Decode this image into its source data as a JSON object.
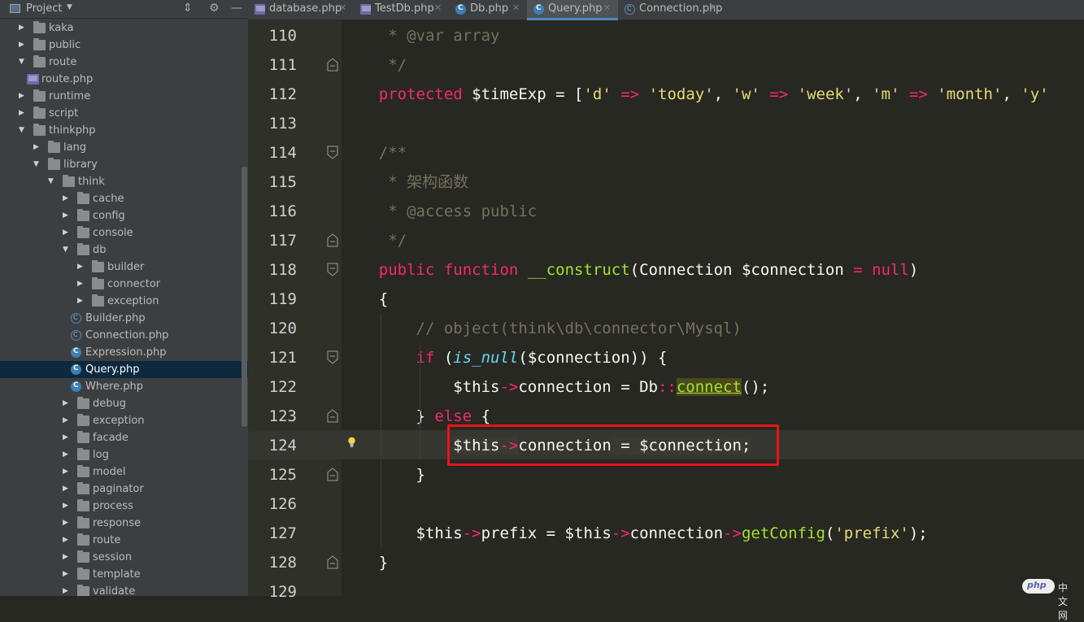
{
  "project_panel": {
    "title": "Project",
    "tree": [
      {
        "label": "kaka",
        "type": "folder",
        "expanded": false,
        "depth": 0
      },
      {
        "label": "public",
        "type": "folder",
        "expanded": false,
        "depth": 0
      },
      {
        "label": "route",
        "type": "folder",
        "expanded": true,
        "depth": 0
      },
      {
        "label": "route.php",
        "type": "php",
        "depth": 1
      },
      {
        "label": "runtime",
        "type": "folder",
        "expanded": false,
        "depth": 0
      },
      {
        "label": "script",
        "type": "folder",
        "expanded": false,
        "depth": 0
      },
      {
        "label": "thinkphp",
        "type": "folder",
        "expanded": true,
        "depth": 0
      },
      {
        "label": "lang",
        "type": "folder",
        "expanded": false,
        "depth": 1
      },
      {
        "label": "library",
        "type": "folder",
        "expanded": true,
        "depth": 1
      },
      {
        "label": "think",
        "type": "folder",
        "expanded": true,
        "depth": 2
      },
      {
        "label": "cache",
        "type": "folder",
        "expanded": false,
        "depth": 3
      },
      {
        "label": "config",
        "type": "folder",
        "expanded": false,
        "depth": 3
      },
      {
        "label": "console",
        "type": "folder",
        "expanded": false,
        "depth": 3
      },
      {
        "label": "db",
        "type": "folder",
        "expanded": true,
        "depth": 3
      },
      {
        "label": "builder",
        "type": "folder",
        "expanded": false,
        "depth": 4
      },
      {
        "label": "connector",
        "type": "folder",
        "expanded": false,
        "depth": 4
      },
      {
        "label": "exception",
        "type": "folder",
        "expanded": false,
        "depth": 4
      },
      {
        "label": "Builder.php",
        "type": "abstract",
        "depth": 4
      },
      {
        "label": "Connection.php",
        "type": "abstract",
        "depth": 4
      },
      {
        "label": "Expression.php",
        "type": "class",
        "depth": 4
      },
      {
        "label": "Query.php",
        "type": "class",
        "depth": 4,
        "selected": true
      },
      {
        "label": "Where.php",
        "type": "class",
        "depth": 4
      },
      {
        "label": "debug",
        "type": "folder",
        "expanded": false,
        "depth": 3
      },
      {
        "label": "exception",
        "type": "folder",
        "expanded": false,
        "depth": 3
      },
      {
        "label": "facade",
        "type": "folder",
        "expanded": false,
        "depth": 3
      },
      {
        "label": "log",
        "type": "folder",
        "expanded": false,
        "depth": 3
      },
      {
        "label": "model",
        "type": "folder",
        "expanded": false,
        "depth": 3
      },
      {
        "label": "paginator",
        "type": "folder",
        "expanded": false,
        "depth": 3
      },
      {
        "label": "process",
        "type": "folder",
        "expanded": false,
        "depth": 3
      },
      {
        "label": "response",
        "type": "folder",
        "expanded": false,
        "depth": 3
      },
      {
        "label": "route",
        "type": "folder",
        "expanded": false,
        "depth": 3
      },
      {
        "label": "session",
        "type": "folder",
        "expanded": false,
        "depth": 3
      },
      {
        "label": "template",
        "type": "folder",
        "expanded": false,
        "depth": 3
      },
      {
        "label": "validate",
        "type": "folder",
        "expanded": false,
        "depth": 3
      }
    ]
  },
  "tabs": [
    {
      "label": "database.php",
      "icon": "php-file-icon",
      "active": false
    },
    {
      "label": "TestDb.php",
      "icon": "php-test-file-icon",
      "active": false
    },
    {
      "label": "Db.php",
      "icon": "class-icon",
      "active": false
    },
    {
      "label": "Query.php",
      "icon": "class-icon",
      "active": true
    },
    {
      "label": "Connection.php",
      "icon": "abstract-class-icon",
      "active": false
    }
  ],
  "editor": {
    "current_line": 124,
    "lines": [
      {
        "n": "110",
        "fold": "",
        "segs": [
          {
            "t": "     * @var array",
            "c": "comment"
          }
        ]
      },
      {
        "n": "111",
        "fold": "end",
        "segs": [
          {
            "t": "     */",
            "c": "comment"
          }
        ]
      },
      {
        "n": "112",
        "fold": "",
        "segs": [
          {
            "t": "    ",
            "c": ""
          },
          {
            "t": "protected",
            "c": "kw"
          },
          {
            "t": " $timeExp = [",
            "c": ""
          },
          {
            "t": "'d'",
            "c": "str"
          },
          {
            "t": " ",
            "c": ""
          },
          {
            "t": "=>",
            "c": "op"
          },
          {
            "t": " ",
            "c": ""
          },
          {
            "t": "'today'",
            "c": "str"
          },
          {
            "t": ", ",
            "c": ""
          },
          {
            "t": "'w'",
            "c": "str"
          },
          {
            "t": " ",
            "c": ""
          },
          {
            "t": "=>",
            "c": "op"
          },
          {
            "t": " ",
            "c": ""
          },
          {
            "t": "'week'",
            "c": "str"
          },
          {
            "t": ", ",
            "c": ""
          },
          {
            "t": "'m'",
            "c": "str"
          },
          {
            "t": " ",
            "c": ""
          },
          {
            "t": "=>",
            "c": "op"
          },
          {
            "t": " ",
            "c": ""
          },
          {
            "t": "'month'",
            "c": "str"
          },
          {
            "t": ", ",
            "c": ""
          },
          {
            "t": "'y'",
            "c": "str"
          }
        ]
      },
      {
        "n": "113",
        "fold": "",
        "segs": []
      },
      {
        "n": "114",
        "fold": "start",
        "segs": [
          {
            "t": "    /**",
            "c": "comment"
          }
        ]
      },
      {
        "n": "115",
        "fold": "",
        "segs": [
          {
            "t": "     * 架构函数",
            "c": "comment"
          }
        ]
      },
      {
        "n": "116",
        "fold": "",
        "segs": [
          {
            "t": "     * @access public",
            "c": "comment"
          }
        ]
      },
      {
        "n": "117",
        "fold": "end",
        "segs": [
          {
            "t": "     */",
            "c": "comment"
          }
        ]
      },
      {
        "n": "118",
        "fold": "start",
        "segs": [
          {
            "t": "    ",
            "c": ""
          },
          {
            "t": "public",
            "c": "kw"
          },
          {
            "t": " ",
            "c": ""
          },
          {
            "t": "function",
            "c": "kw"
          },
          {
            "t": " ",
            "c": ""
          },
          {
            "t": "__construct",
            "c": "func"
          },
          {
            "t": "(Connection $connection ",
            "c": ""
          },
          {
            "t": "=",
            "c": "op"
          },
          {
            "t": " ",
            "c": ""
          },
          {
            "t": "null",
            "c": "kw"
          },
          {
            "t": ")",
            "c": ""
          }
        ]
      },
      {
        "n": "119",
        "fold": "",
        "segs": [
          {
            "t": "    {",
            "c": ""
          }
        ]
      },
      {
        "n": "120",
        "fold": "",
        "segs": [
          {
            "t": "        // object(think\\db\\connector\\Mysql)",
            "c": "comment"
          }
        ]
      },
      {
        "n": "121",
        "fold": "start",
        "segs": [
          {
            "t": "        ",
            "c": ""
          },
          {
            "t": "if",
            "c": "kw"
          },
          {
            "t": " (",
            "c": ""
          },
          {
            "t": "is_null",
            "c": "builtin"
          },
          {
            "t": "($connection)) {",
            "c": ""
          }
        ]
      },
      {
        "n": "122",
        "fold": "",
        "segs": [
          {
            "t": "            $this",
            "c": ""
          },
          {
            "t": "->",
            "c": "op"
          },
          {
            "t": "connection = Db",
            "c": ""
          },
          {
            "t": "::",
            "c": "op"
          },
          {
            "t": "connect",
            "c": "under"
          },
          {
            "t": "();",
            "c": ""
          }
        ]
      },
      {
        "n": "123",
        "fold": "mid",
        "segs": [
          {
            "t": "        } ",
            "c": ""
          },
          {
            "t": "else",
            "c": "kw"
          },
          {
            "t": " {",
            "c": ""
          }
        ]
      },
      {
        "n": "124",
        "fold": "",
        "segs": [
          {
            "t": "            ",
            "c": ""
          },
          {
            "t": "$this",
            "c": "hl"
          },
          {
            "t": "->",
            "c": "op hl"
          },
          {
            "t": "connection",
            "c": ""
          },
          {
            "t": " = $connection;",
            "c": "hl"
          }
        ]
      },
      {
        "n": "125",
        "fold": "end",
        "segs": [
          {
            "t": "        }",
            "c": ""
          }
        ]
      },
      {
        "n": "126",
        "fold": "",
        "segs": []
      },
      {
        "n": "127",
        "fold": "",
        "segs": [
          {
            "t": "        $this",
            "c": ""
          },
          {
            "t": "->",
            "c": "op"
          },
          {
            "t": "prefix = $this",
            "c": ""
          },
          {
            "t": "->",
            "c": "op"
          },
          {
            "t": "connection",
            "c": ""
          },
          {
            "t": "->",
            "c": "op"
          },
          {
            "t": "getConfig",
            "c": "func"
          },
          {
            "t": "(",
            "c": ""
          },
          {
            "t": "'prefix'",
            "c": "str"
          },
          {
            "t": ");",
            "c": ""
          }
        ]
      },
      {
        "n": "128",
        "fold": "end",
        "segs": [
          {
            "t": "    }",
            "c": ""
          }
        ]
      },
      {
        "n": "129",
        "fold": "",
        "segs": []
      }
    ]
  },
  "watermark": {
    "logo": "php",
    "text": "中文网"
  },
  "colors": {
    "highlight_box": "#e8141b",
    "selection": "#0d293e",
    "tab_underline": "#4a88c7"
  }
}
